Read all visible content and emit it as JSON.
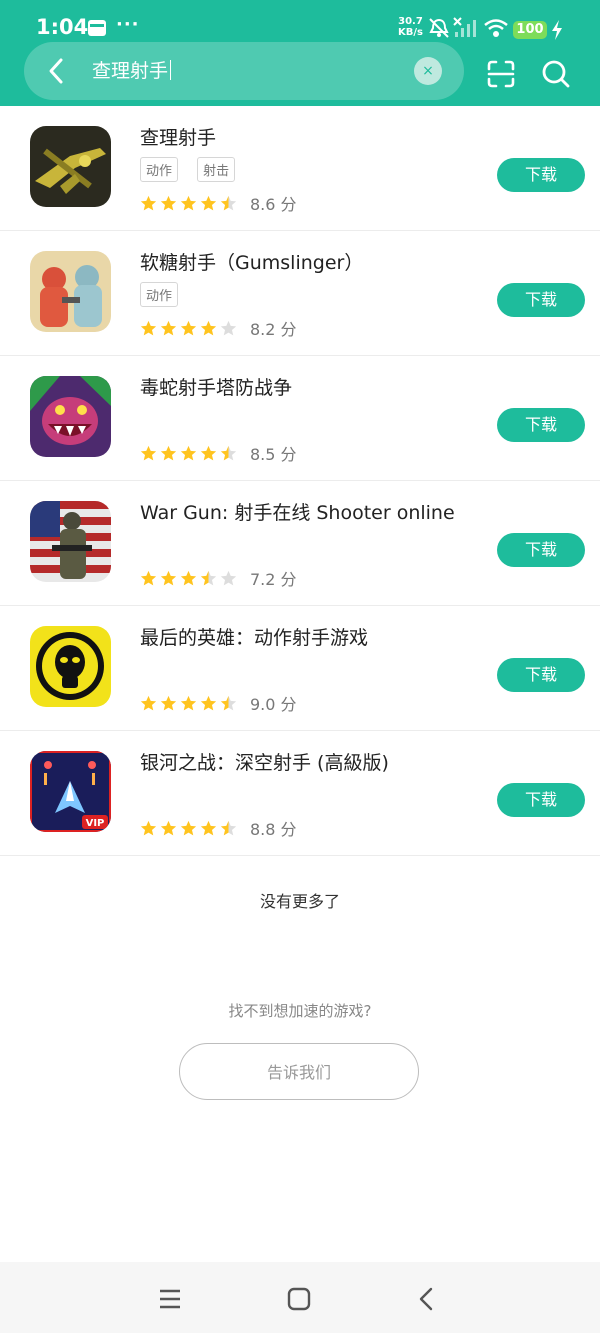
{
  "status_bar": {
    "time": "1:04",
    "more": "···",
    "speed_value": "30.7",
    "speed_unit": "KB/s",
    "battery": "100"
  },
  "search": {
    "query": "查理射手",
    "clear_symbol": "×"
  },
  "colors": {
    "accent": "#1ebc9c",
    "star": "#ffc41f",
    "star_empty": "#dddddd"
  },
  "results": [
    {
      "name": "查理射手",
      "tags": [
        "动作",
        "射击"
      ],
      "rating": 4.5,
      "score_label": "8.6 分",
      "button": "下载"
    },
    {
      "name": "软糖射手（Gumslinger）",
      "tags": [
        "动作"
      ],
      "rating": 4,
      "score_label": "8.2 分",
      "button": "下载"
    },
    {
      "name": "毒蛇射手塔防战争",
      "tags": [],
      "rating": 4.5,
      "score_label": "8.5 分",
      "button": "下载"
    },
    {
      "name": "War Gun: 射手在线 Shooter online",
      "tags": [],
      "rating": 3.5,
      "score_label": "7.2 分",
      "button": "下载"
    },
    {
      "name": "最后的英雄：动作射手游戏",
      "tags": [],
      "rating": 4.5,
      "score_label": "9.0 分",
      "button": "下载"
    },
    {
      "name": "银河之战：深空射手 (高級版)",
      "tags": [],
      "rating": 4.5,
      "score_label": "8.8 分",
      "button": "下载"
    }
  ],
  "footer": {
    "no_more": "没有更多了",
    "not_found": "找不到想加速的游戏?",
    "tell_us": "告诉我们"
  }
}
